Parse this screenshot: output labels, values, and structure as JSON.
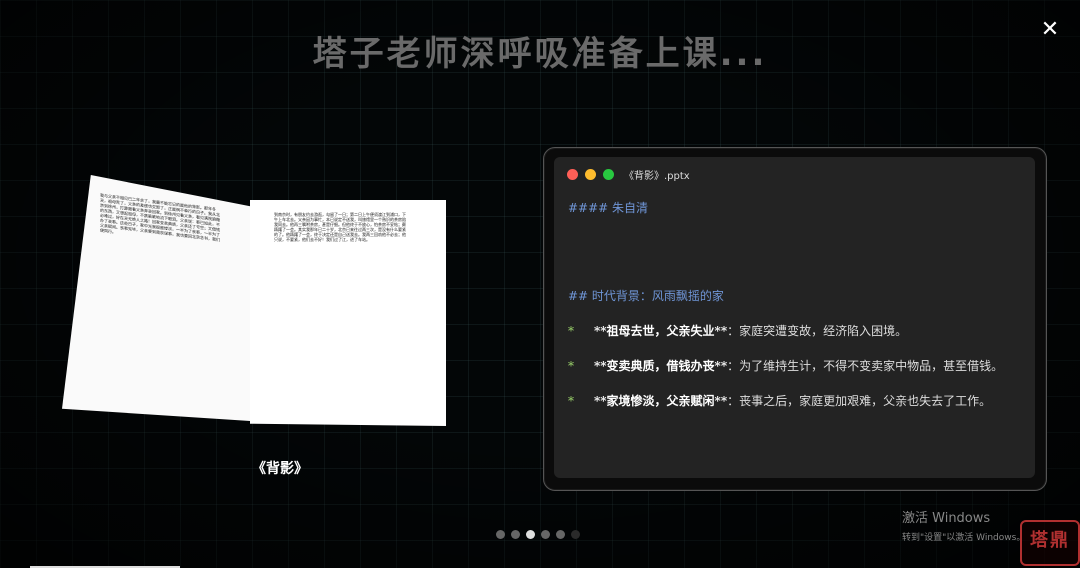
{
  "headline": "塔子老师深呼吸准备上课...",
  "close_icon": "close-icon",
  "book": {
    "title": "《背影》",
    "left_page_text": "我与父亲不相见已二年余了，我最不能忘记的是他的背影。那年冬天，祖母死了，父亲的差使也交卸了，正是祸不单行的日子。我从北京到徐州，打算跟着父亲奔丧回家。到徐州见着父亲，看见满院狼藉的东西，又想起祖母，不禁簌簌地流下眼泪。父亲说：事已如此，不必难过，好在天无绝人之路！回家变卖典质，父亲还了亏空；又借钱办了丧事。这些日子，家中光景很是惨淡，一半为了丧事，一半为了父亲赋闲。丧事完毕，父亲要到南京谋事，我也要回北京念书，我们便同行。",
    "right_page_text": "到南京时，有朋友约去游逛，勾留了一日；第二日上午便须渡江到浦口，下午上车北去。父亲因为事忙，本已说定不送我，叫旅馆里一个熟识的茶房陪我同去。他再三嘱咐茶房，甚是仔细。但他终于不放心，怕茶房不妥帖；颇踌躇了一会。其实我那年已二十岁，北京已来往过两三次，是没有什么要紧的了。他踌躇了一会，终于决定还是自己送我去。我两三回劝他不必去；他只说，不要紧，他们去不好！我们过了江，进了车站。"
  },
  "window": {
    "title": "《背影》.pptx",
    "h4": "#### 朱自清",
    "h2": "## 时代背景：风雨飘摇的家",
    "items": [
      {
        "star": "*",
        "bold": "**祖母去世，父亲失业**",
        "text": "：家庭突遭变故，经济陷入困境。"
      },
      {
        "star": "*",
        "bold": "**变卖典质，借钱办丧**",
        "text": "：为了维持生计，不得不变卖家中物品，甚至借钱。"
      },
      {
        "star": "*",
        "bold": "**家境惨淡，父亲赋闲**",
        "text": "：丧事之后，家庭更加艰难，父亲也失去了工作。"
      }
    ]
  },
  "pagination": {
    "count": 6,
    "active_index": 2
  },
  "activation": {
    "line1": "激活 Windows",
    "line2": "转到\"设置\"以激活 Windows。"
  },
  "seal_text": "塔鼎"
}
